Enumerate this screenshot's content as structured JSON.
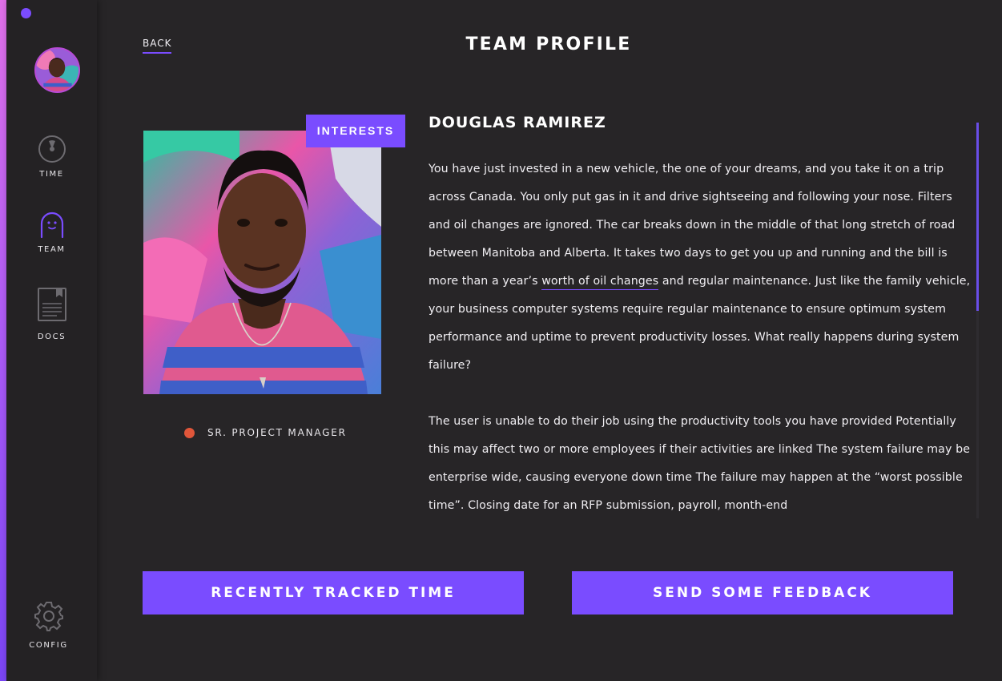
{
  "colors": {
    "accent": "#7a4cff",
    "background": "#272527",
    "sidebar": "#242224",
    "status_dot": "#e0563a"
  },
  "sidebar": {
    "items": [
      {
        "label": "TIME",
        "icon": "stopwatch-icon"
      },
      {
        "label": "TEAM",
        "icon": "team-face-icon"
      },
      {
        "label": "DOCS",
        "icon": "document-icon"
      },
      {
        "label": "CONFIG",
        "icon": "gear-icon"
      }
    ]
  },
  "header": {
    "back_label": "BACK",
    "title": "TEAM PROFILE"
  },
  "profile": {
    "interests_label": "INTERESTS",
    "name": "DOUGLAS RAMIREZ",
    "role": "SR. PROJECT MANAGER",
    "bio": {
      "p1_before_link": "You have just invested in a new vehicle, the one of your dreams, and you take it on a trip across Canada. You only put gas in it and drive sightseeing and following your nose. Filters and oil changes are ignored. The car breaks down in the middle of that long stretch of road between Manitoba and Alberta. It takes two days to get you up and running and the bill is more than a year’s ",
      "p1_link": "worth of oil changes",
      "p1_after_link": " and regular maintenance. Just like the family vehicle, your business computer systems require regular maintenance to ensure optimum system performance and uptime to prevent productivity losses. What really happens during system failure?",
      "p2": "The user is unable to do their job using the productivity tools you have provided Potentially this may affect two or more employees if their activities are linked The system failure may be enterprise wide, causing everyone down time The failure may happen at the “worst possible time”. Closing date for an RFP submission, payroll, month-end"
    }
  },
  "actions": {
    "tracked_time_label": "RECENTLY TRACKED TIME",
    "feedback_label": "SEND SOME FEEDBACK"
  }
}
